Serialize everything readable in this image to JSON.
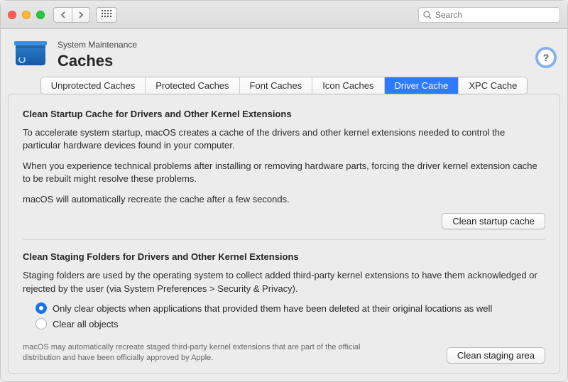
{
  "toolbar": {
    "search_placeholder": "Search"
  },
  "header": {
    "breadcrumb": "System Maintenance",
    "title": "Caches",
    "help_glyph": "?"
  },
  "tabs": [
    {
      "label": "Unprotected Caches",
      "active": false
    },
    {
      "label": "Protected Caches",
      "active": false
    },
    {
      "label": "Font Caches",
      "active": false
    },
    {
      "label": "Icon Caches",
      "active": false
    },
    {
      "label": "Driver Cache",
      "active": true
    },
    {
      "label": "XPC Cache",
      "active": false
    }
  ],
  "section1": {
    "title": "Clean Startup Cache for Drivers and Other Kernel Extensions",
    "p1": "To accelerate system startup, macOS creates a cache of the drivers and other kernel extensions needed to control the particular hardware devices found in your computer.",
    "p2": "When you experience technical problems after installing or removing hardware parts, forcing the driver kernel extension cache to be rebuilt might resolve these problems.",
    "p3": "macOS will automatically recreate the cache after a few seconds.",
    "button": "Clean startup cache"
  },
  "section2": {
    "title": "Clean Staging Folders for Drivers and Other Kernel Extensions",
    "p1": "Staging folders are used by the operating system to collect added third-party kernel extensions to have them acknowledged or rejected by the user (via System Preferences > Security & Privacy).",
    "radio1": "Only clear objects when applications that provided them have been deleted at their original locations as well",
    "radio2": "Clear all objects",
    "footnote": "macOS may automatically recreate staged third-party kernel extensions that are part of the official distribution and have been officially approved by Apple.",
    "button": "Clean staging area"
  }
}
